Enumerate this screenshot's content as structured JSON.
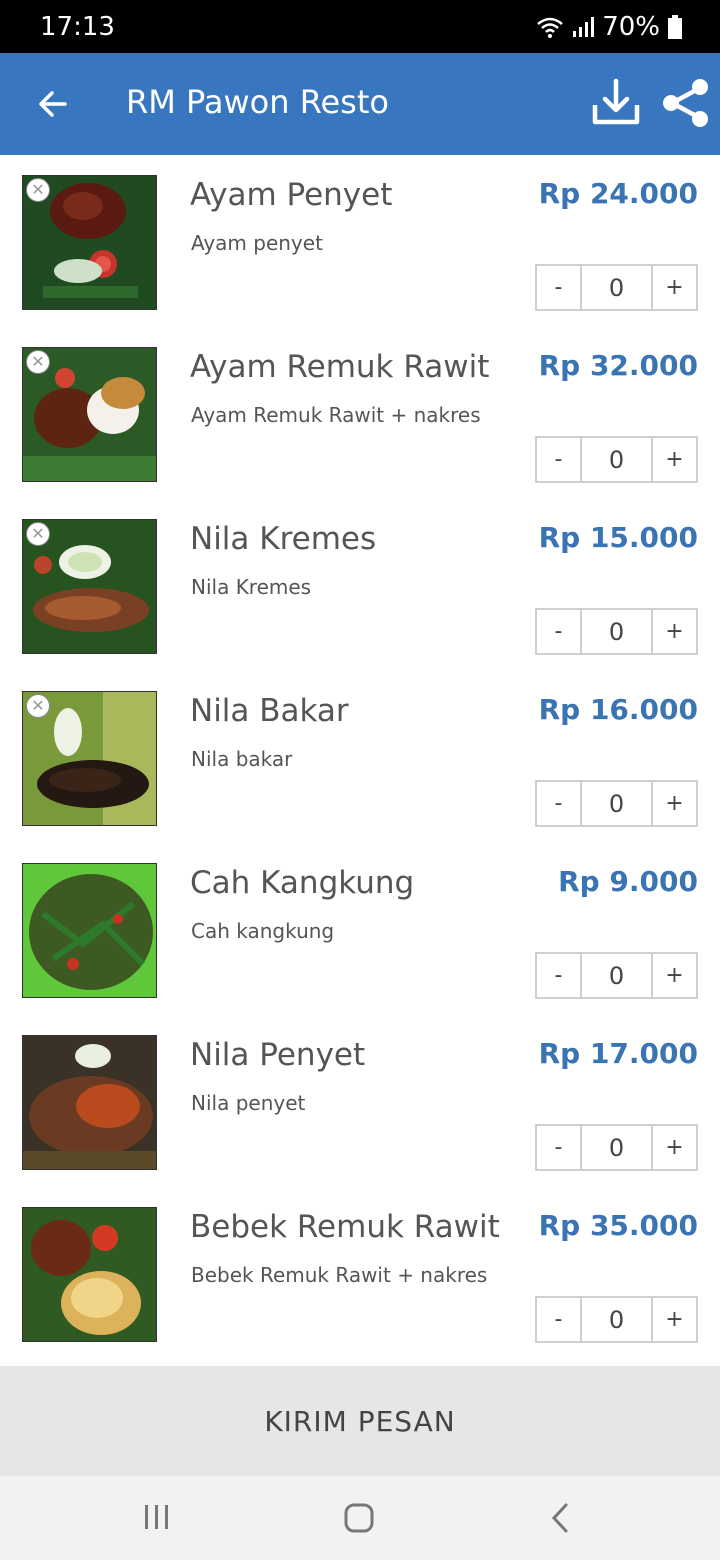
{
  "status_bar": {
    "time": "17:13",
    "battery": "70%"
  },
  "app_bar": {
    "title": "RM Pawon Resto",
    "back_icon": "arrow-left-icon",
    "download_icon": "download-icon",
    "share_icon": "share-icon"
  },
  "menu": {
    "items": [
      {
        "name": "Ayam Penyet",
        "desc": "Ayam penyet",
        "price": "Rp 24.000",
        "qty": "0",
        "minus": "-",
        "plus": "+"
      },
      {
        "name": "Ayam Remuk Rawit",
        "desc": "Ayam Remuk Rawit + nakres",
        "price": "Rp 32.000",
        "qty": "0",
        "minus": "-",
        "plus": "+"
      },
      {
        "name": "Nila Kremes",
        "desc": "Nila Kremes",
        "price": "Rp 15.000",
        "qty": "0",
        "minus": "-",
        "plus": "+"
      },
      {
        "name": "Nila Bakar",
        "desc": "Nila bakar",
        "price": "Rp 16.000",
        "qty": "0",
        "minus": "-",
        "plus": "+"
      },
      {
        "name": "Cah Kangkung",
        "desc": "Cah kangkung",
        "price": "Rp 9.000",
        "qty": "0",
        "minus": "-",
        "plus": "+"
      },
      {
        "name": "Nila Penyet",
        "desc": "Nila penyet",
        "price": "Rp 17.000",
        "qty": "0",
        "minus": "-",
        "plus": "+"
      },
      {
        "name": "Bebek Remuk Rawit",
        "desc": "Bebek Remuk Rawit + nakres",
        "price": "Rp 35.000",
        "qty": "0",
        "minus": "-",
        "plus": "+"
      }
    ]
  },
  "send_button": {
    "label": "KIRIM PESAN"
  },
  "colors": {
    "app_bar": "#3876c0",
    "price": "#3a74b2"
  }
}
